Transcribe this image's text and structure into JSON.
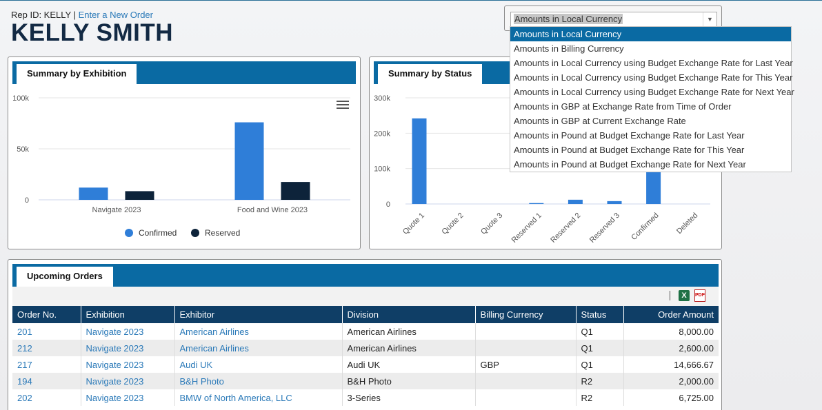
{
  "header": {
    "rep_label": "Rep ID: KELLY",
    "separator": "|",
    "new_order_link": "Enter a New Order",
    "rep_name": "KELLY SMITH"
  },
  "currency": {
    "selected": "Amounts in Local Currency",
    "options": [
      "Amounts in Local Currency",
      "Amounts in Billing Currency",
      "Amounts in Local Currency using Budget Exchange Rate for Last Year",
      "Amounts in Local Currency using Budget Exchange Rate for This Year",
      "Amounts in Local Currency using Budget Exchange Rate for Next Year",
      "Amounts in GBP at Exchange Rate from Time of Order",
      "Amounts in GBP at Current Exchange Rate",
      "Amounts in Pound at Budget Exchange Rate for Last Year",
      "Amounts in Pound at Budget Exchange Rate for This Year",
      "Amounts in Pound at Budget Exchange Rate for Next Year"
    ]
  },
  "panels": {
    "exhibition_title": "Summary by Exhibition",
    "status_title": "Summary by Status",
    "orders_title": "Upcoming Orders"
  },
  "colors": {
    "confirmed": "#2f7ed8",
    "reserved": "#0d233a",
    "header_bar": "#0a6aa3",
    "table_header": "#0f3e66"
  },
  "icons": {
    "menu": "hamburger-icon",
    "excel": "excel-icon",
    "pdf": "pdf-icon"
  },
  "chart_data": [
    {
      "type": "bar",
      "title": "Summary by Exhibition",
      "categories": [
        "Navigate 2023",
        "Food and Wine 2023"
      ],
      "series": [
        {
          "name": "Confirmed",
          "values": [
            12000,
            76000
          ]
        },
        {
          "name": "Reserved",
          "values": [
            8500,
            17500
          ]
        }
      ],
      "yticks": [
        "0",
        "50k",
        "100k"
      ],
      "ylim": [
        0,
        100000
      ],
      "grid": true,
      "legend": "bottom"
    },
    {
      "type": "bar",
      "title": "Summary by Status",
      "categories": [
        "Quote 1",
        "Quote 2",
        "Quote 3",
        "Reserved 1",
        "Reserved 2",
        "Reserved 3",
        "Confirmed",
        "Deleted"
      ],
      "values": [
        242000,
        0,
        0,
        2500,
        12000,
        8000,
        90000,
        0
      ],
      "yticks": [
        "0",
        "100k",
        "200k",
        "300k"
      ],
      "ylim": [
        0,
        300000
      ],
      "grid": true
    }
  ],
  "orders": {
    "columns": [
      "Order No.",
      "Exhibition",
      "Exhibitor",
      "Division",
      "Billing Currency",
      "Status",
      "Order Amount"
    ],
    "rows": [
      [
        "201",
        "Navigate 2023",
        "American Airlines",
        "American Airlines",
        "",
        "Q1",
        "8,000.00"
      ],
      [
        "212",
        "Navigate 2023",
        "American Airlines",
        "American Airlines",
        "",
        "Q1",
        "2,600.00"
      ],
      [
        "217",
        "Navigate 2023",
        "Audi UK",
        "Audi UK",
        "GBP",
        "Q1",
        "14,666.67"
      ],
      [
        "194",
        "Navigate 2023",
        "B&H Photo",
        "B&H Photo",
        "",
        "R2",
        "2,000.00"
      ],
      [
        "202",
        "Navigate 2023",
        "BMW of North America, LLC",
        "3-Series",
        "",
        "R2",
        "6,725.00"
      ]
    ]
  }
}
